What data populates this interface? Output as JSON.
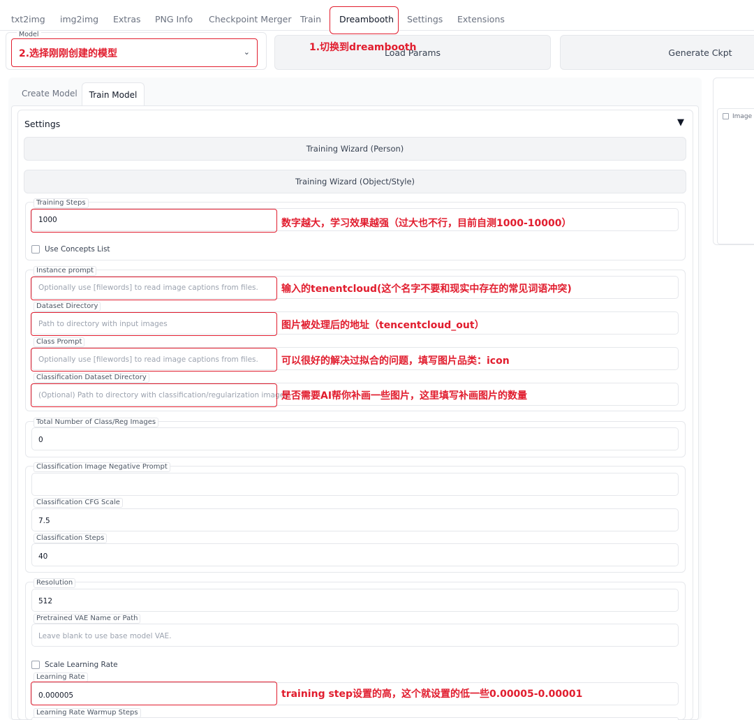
{
  "top_tabs": [
    "txt2img",
    "img2img",
    "Extras",
    "PNG Info",
    "Checkpoint Merger",
    "Train",
    "Dreambooth",
    "Settings",
    "Extensions"
  ],
  "annotation_switch": "1.切换到dreambooth",
  "model": {
    "label": "Model",
    "annotation": "2.选择刚刚创建的模型",
    "chevron": "⌄"
  },
  "buttons": {
    "load_params": "Load Params",
    "generate_ckpt": "Generate Ckpt"
  },
  "subtabs": {
    "create_model": "Create Model",
    "train_model": "Train Model"
  },
  "settings": {
    "title": "Settings",
    "toggle": "▼",
    "wizard_person": "Training Wizard (Person)",
    "wizard_object": "Training Wizard (Object/Style)"
  },
  "fields": {
    "training_steps": {
      "label": "Training Steps",
      "value": "1000",
      "note": "数字越大，学习效果越强（过大也不行，目前自测1000-10000）"
    },
    "use_concepts": {
      "label": "Use Concepts List"
    },
    "instance_prompt": {
      "label": "Instance prompt",
      "placeholder": "Optionally use [filewords] to read image captions from files.",
      "note": "输入的tenentcloud(这个名字不要和现实中存在的常见词语冲突)"
    },
    "dataset_dir": {
      "label": "Dataset Directory",
      "placeholder": "Path to directory with input images",
      "note": "图片被处理后的地址（tencentcloud_out）"
    },
    "class_prompt": {
      "label": "Class Prompt",
      "placeholder": "Optionally use [filewords] to read image captions from files.",
      "note": "可以很好的解决过拟合的问题，填写图片品类：icon"
    },
    "class_dataset_dir": {
      "label": "Classification Dataset Directory",
      "placeholder": "(Optional) Path to directory with classification/regularization images",
      "note": "是否需要AI帮你补画一些图片，这里填写补画图片的数量"
    },
    "total_class_images": {
      "label": "Total Number of Class/Reg Images",
      "value": "0"
    },
    "class_negative_prompt": {
      "label": "Classification Image Negative Prompt",
      "value": ""
    },
    "class_cfg_scale": {
      "label": "Classification CFG Scale",
      "value": "7.5"
    },
    "class_steps": {
      "label": "Classification Steps",
      "value": "40"
    },
    "resolution": {
      "label": "Resolution",
      "value": "512"
    },
    "vae": {
      "label": "Pretrained VAE Name or Path",
      "placeholder": "Leave blank to use base model VAE."
    },
    "scale_lr": {
      "label": "Scale Learning Rate"
    },
    "learning_rate": {
      "label": "Learning Rate",
      "value": "0.000005",
      "note": "training  step设置的高，这个就设置的低一些0.00005-0.00001"
    },
    "lr_warmup": {
      "label": "Learning Rate Warmup Steps"
    }
  },
  "image_panel": {
    "label": "Image"
  },
  "colors": {
    "annotation_red": "#e11d2e",
    "border": "#e5e7eb"
  }
}
